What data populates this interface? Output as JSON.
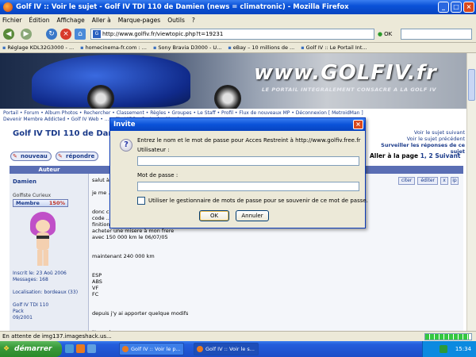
{
  "window": {
    "title": "Golf IV :: Voir le sujet - Golf IV TDI 110 de Damien (news = climatronic) - Mozilla Firefox"
  },
  "menu": [
    "Fichier",
    "Édition",
    "Affichage",
    "Aller à",
    "Marque-pages",
    "Outils",
    "?"
  ],
  "nav": {
    "url": "http://www.golfiv.fr/viewtopic.php?t=19231",
    "go_label": "OK",
    "search_value": ""
  },
  "bookmarks": [
    "Réglage KDL32G3000 - ...",
    "homecinema-fr.com : ...",
    "Sony Bravia D3000 - U...",
    "eBay – 10 millions de ...",
    "Golf IV :: Le Portail Int..."
  ],
  "banner": {
    "logo": "www.GOLFIV.fr",
    "tagline": "LE PORTAIL INTEGRALEMENT CONSACRE A LA GOLF IV"
  },
  "site_nav": {
    "row1": "Portail • Forum • Album Photos • Rechercher • Classement • Règles • Groupes • Le Staff • Profil • Flux de nouveaux MP • Déconnexion [ MetroidMan ]",
    "row2": "Devenir Membre Addicted • Golf IV Web • ... • Chat/IRC • Carte des Membres"
  },
  "thread": {
    "title": "Golf IV TDI 110 de Damien",
    "right_link_1": "Voir le sujet suivant",
    "right_link_2": "Voir le sujet précédent",
    "right_link_3": "Surveiller les réponses de ce sujet",
    "pager_prefix": "Aller à la page",
    "pager_pages": "1, 2",
    "pager_next": "Suivant",
    "new_label": "nouveau",
    "reply_label": "répondre"
  },
  "table": {
    "author_header": "Auteur"
  },
  "author": {
    "name": "Damien",
    "rank": "Golfiste Curieux",
    "badge": "Membre",
    "badge_pct": "150%",
    "stats": [
      "Inscrit le: 23 Aoû 2006",
      "Messages: 168",
      "",
      "Localisation: bordeaux (33)",
      "",
      "Golf IV TDI 110",
      "Pack",
      "09/2001"
    ]
  },
  "post": {
    "text": "salut à...\n\nje me ...\n\n\ndonc c...\ncode ...\nfinition CARE\nacheter une misere à mon frere\navec 150 000 km le 06/07/05\n\n\nmaintenant 240 000 km\n\n\nESP\nABS\nVF\nFC\n\n\ndepuis j'y ai apporter quelque modifs\n\n\nNormal",
    "btn_quote": "citer",
    "btn_edit": "éditer",
    "btn_x": "x",
    "btn_ip": "ip"
  },
  "dialog": {
    "title": "Invite",
    "message": "Entrez le nom et le mot de passe pour Acces Restreint à http://www.golfiv.free.fr",
    "user_label": "Utilisateur :",
    "user_value": "",
    "pass_label": "Mot de passe :",
    "pass_value": "",
    "remember_label": "Utiliser le gestionnaire de mots de passe pour se souvenir de ce mot de passe.",
    "remember_checked": false,
    "ok_label": "OK",
    "cancel_label": "Annuler"
  },
  "status": {
    "text": "En attente de img137.imageshack.us...",
    "progress_fraction": 0.95
  },
  "taskbar": {
    "start_label": "démarrer",
    "tasks": [
      "Golf IV :: Voir le p...",
      "Golf IV :: Voir le s..."
    ],
    "clock": "15:34"
  }
}
